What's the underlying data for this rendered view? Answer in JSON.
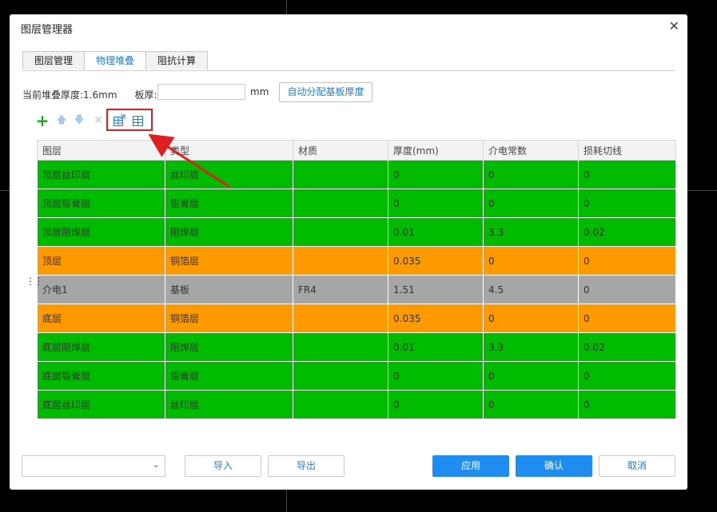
{
  "window": {
    "title": "图层管理器",
    "close_glyph": "✕"
  },
  "tabs": [
    {
      "label": "图层管理",
      "active": false
    },
    {
      "label": "物理堆叠",
      "active": true
    },
    {
      "label": "阻抗计算",
      "active": false
    }
  ],
  "stack": {
    "current_thickness_label": "当前堆叠厚度:1.6mm",
    "board_thickness_label": "板厚:",
    "board_thickness_value": "",
    "unit": "mm",
    "auto_button": "自动分配基板厚度"
  },
  "toolbar": {
    "icons": [
      "add-icon",
      "move-up-icon",
      "move-down-icon",
      "delete-icon",
      "export-layer-icon",
      "import-layer-icon"
    ],
    "add_glyph": "+",
    "up_glyph": "🡅",
    "down_glyph": "🡇",
    "delete_glyph": "✕"
  },
  "colors": {
    "green": "#00bb00",
    "orange": "#ff9900",
    "gray": "#a6a6a6",
    "accent": "#1e8cf0",
    "highlight": "#e02020"
  },
  "table": {
    "headers": [
      "图层",
      "类型",
      "材质",
      "厚度(mm)",
      "介电常数",
      "损耗切线"
    ],
    "rows": [
      {
        "color": "green",
        "cells": [
          "顶层丝印层",
          "丝印层",
          "",
          "0",
          "0",
          "0"
        ]
      },
      {
        "color": "green",
        "cells": [
          "顶层锡膏层",
          "锡膏层",
          "",
          "0",
          "0",
          "0"
        ]
      },
      {
        "color": "green",
        "cells": [
          "顶层阻焊层",
          "阻焊层",
          "",
          "0.01",
          "3.3",
          "0.02"
        ]
      },
      {
        "color": "orange",
        "cells": [
          "顶层",
          "铜箔层",
          "",
          "0.035",
          "0",
          "0"
        ]
      },
      {
        "color": "gray",
        "cells": [
          "介电1",
          "基板",
          "FR4",
          "1.51",
          "4.5",
          "0"
        ]
      },
      {
        "color": "orange",
        "cells": [
          "底层",
          "铜箔层",
          "",
          "0.035",
          "0",
          "0"
        ]
      },
      {
        "color": "green",
        "cells": [
          "底层阻焊层",
          "阻焊层",
          "",
          "0.01",
          "3.3",
          "0.02"
        ]
      },
      {
        "color": "green",
        "cells": [
          "底层锡膏层",
          "锡膏层",
          "",
          "0",
          "0",
          "0"
        ]
      },
      {
        "color": "green",
        "cells": [
          "底层丝印层",
          "丝印层",
          "",
          "0",
          "0",
          "0"
        ]
      }
    ]
  },
  "footer": {
    "select_value": "",
    "import_label": "导入",
    "export_label": "导出",
    "apply_label": "应用",
    "confirm_label": "确认",
    "cancel_label": "取消"
  }
}
